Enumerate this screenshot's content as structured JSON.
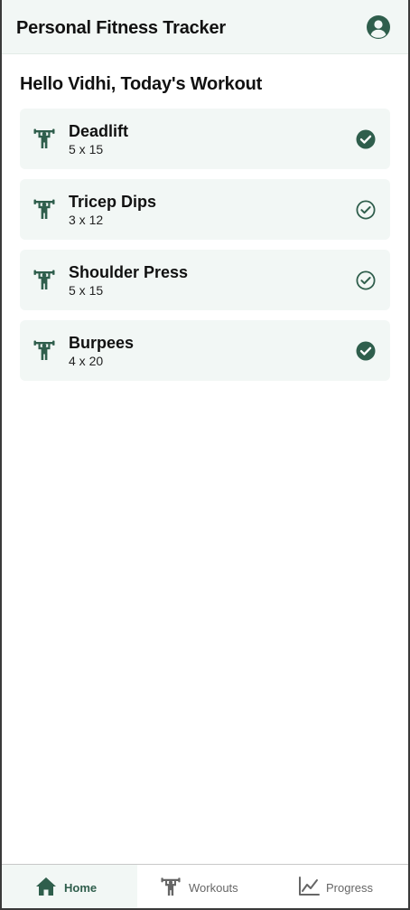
{
  "header": {
    "title": "Personal Fitness Tracker",
    "profile_icon": "user-circle-icon"
  },
  "greeting": "Hello Vidhi, Today's Workout",
  "workouts": [
    {
      "name": "Deadlift",
      "sets": "5 x 15",
      "completed": true
    },
    {
      "name": "Tricep Dips",
      "sets": "3 x 12",
      "completed": false
    },
    {
      "name": "Shoulder Press",
      "sets": "5 x 15",
      "completed": false
    },
    {
      "name": "Burpees",
      "sets": "4 x 20",
      "completed": true
    }
  ],
  "nav": [
    {
      "label": "Home",
      "icon": "home-icon",
      "active": true
    },
    {
      "label": "Workouts",
      "icon": "weightlifter-icon",
      "active": false
    },
    {
      "label": "Progress",
      "icon": "line-chart-icon",
      "active": false
    }
  ],
  "colors": {
    "accent": "#2f5e4c",
    "surface": "#f2f7f5",
    "inactive": "#666666"
  }
}
